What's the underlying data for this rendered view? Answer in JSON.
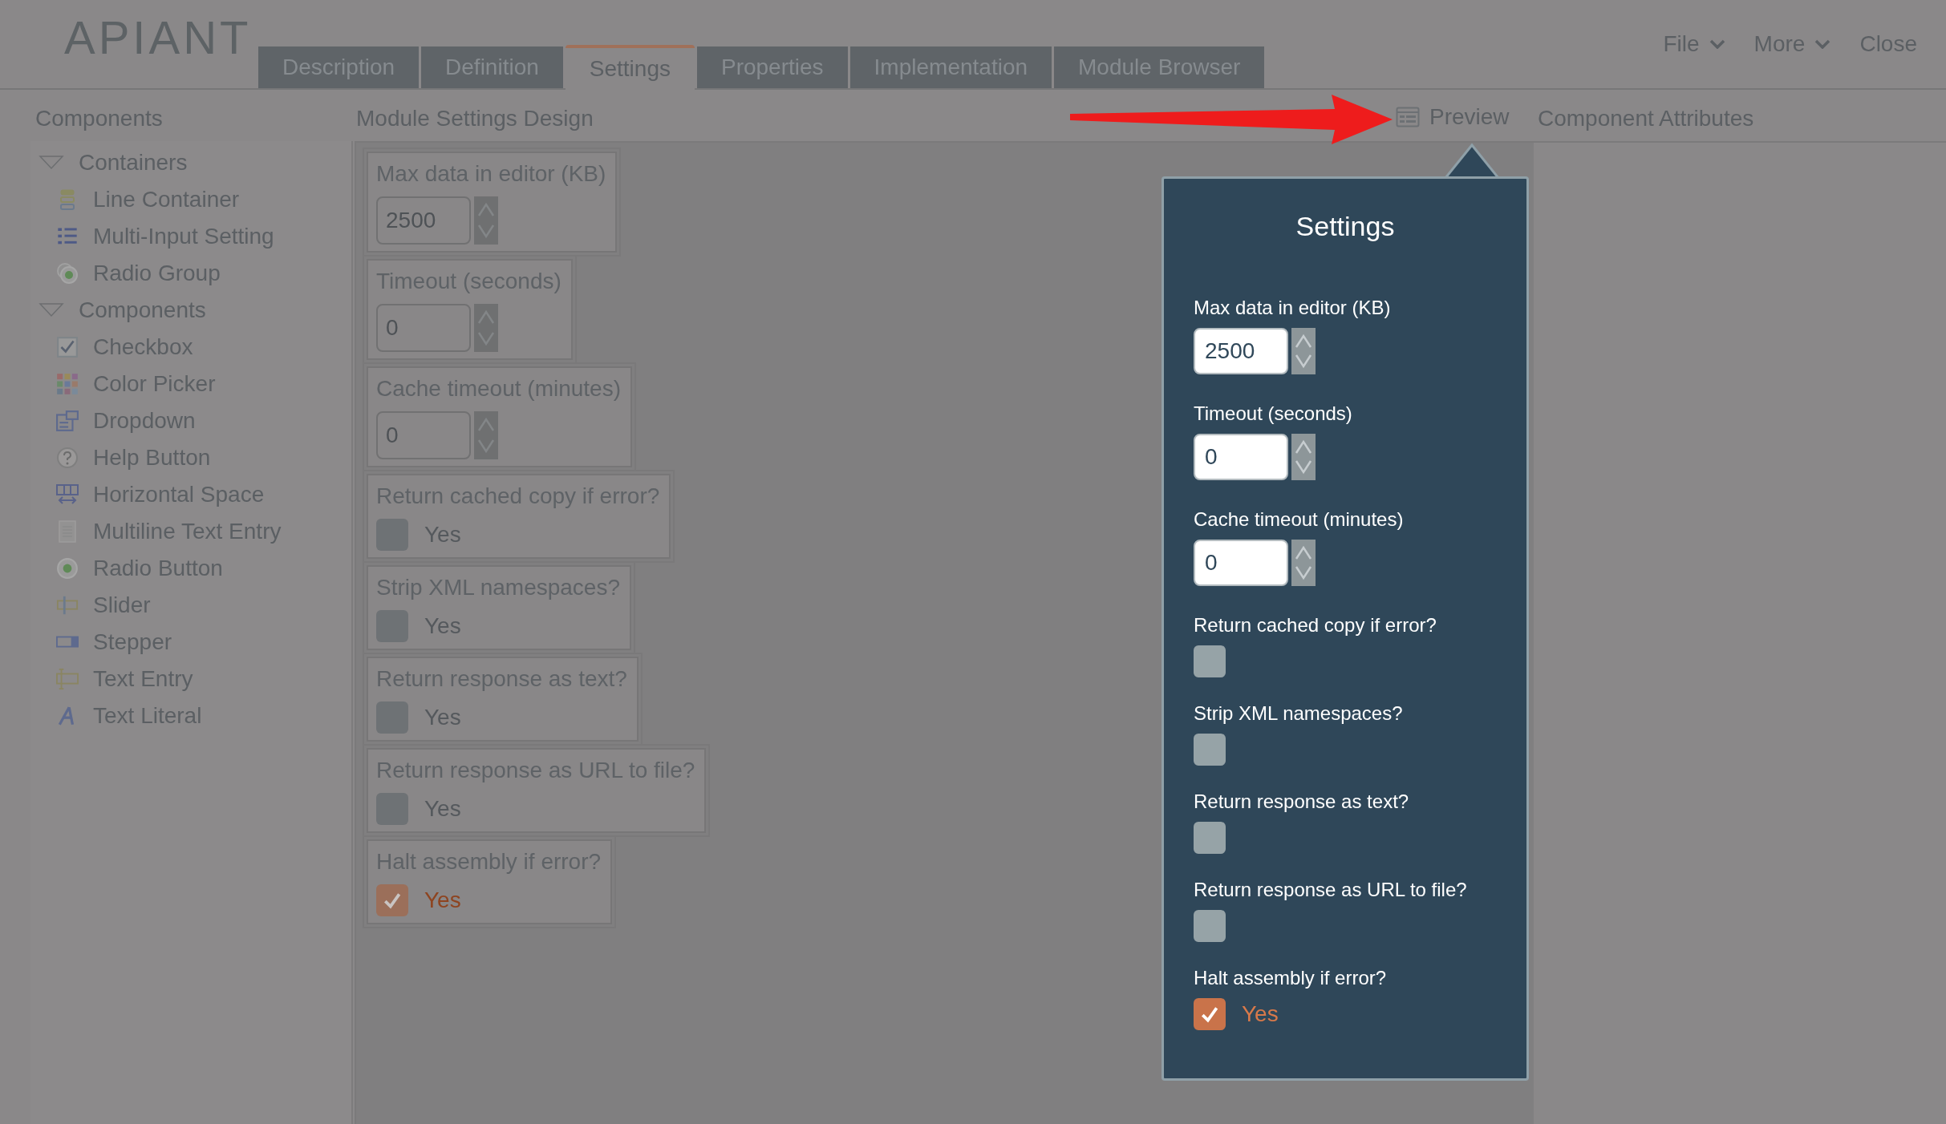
{
  "logo": "APIANT",
  "tabs": [
    {
      "label": "Description",
      "selected": false
    },
    {
      "label": "Definition",
      "selected": false
    },
    {
      "label": "Settings",
      "selected": true
    },
    {
      "label": "Properties",
      "selected": false
    },
    {
      "label": "Implementation",
      "selected": false
    },
    {
      "label": "Module Browser",
      "selected": false
    }
  ],
  "menu": [
    {
      "label": "File",
      "kind": "dropdown"
    },
    {
      "label": "More",
      "kind": "dropdown"
    },
    {
      "label": "Close",
      "kind": "link"
    }
  ],
  "components_panel": {
    "title": "Components",
    "tree": [
      {
        "label": "Containers",
        "expanded": true,
        "children": [
          {
            "label": "Line Container",
            "kind": "stack"
          },
          {
            "label": "Multi-Input Setting",
            "kind": "list"
          },
          {
            "label": "Radio Group",
            "kind": "radiogroup"
          }
        ]
      },
      {
        "label": "Components",
        "expanded": true,
        "children": [
          {
            "label": "Checkbox",
            "kind": "checkbox"
          },
          {
            "label": "Color Picker",
            "kind": "palette"
          },
          {
            "label": "Dropdown",
            "kind": "dropdown"
          },
          {
            "label": "Help Button",
            "kind": "help"
          },
          {
            "label": "Horizontal Space",
            "kind": "hspace"
          },
          {
            "label": "Multiline Text Entry",
            "kind": "document"
          },
          {
            "label": "Radio Button",
            "kind": "radio"
          },
          {
            "label": "Slider",
            "kind": "slider"
          },
          {
            "label": "Stepper",
            "kind": "stepper"
          },
          {
            "label": "Text Entry",
            "kind": "textentry"
          },
          {
            "label": "Text Literal",
            "kind": "literal"
          }
        ]
      }
    ]
  },
  "design": {
    "title": "Module Settings Design",
    "fields": [
      {
        "kind": "number",
        "label": "Max data in editor (KB)",
        "value": "2500"
      },
      {
        "kind": "number",
        "label": "Timeout (seconds)",
        "value": "0"
      },
      {
        "kind": "number",
        "label": "Cache timeout (minutes)",
        "value": "0"
      },
      {
        "kind": "checkbox",
        "label": "Return cached copy if error?",
        "option": "Yes",
        "checked": false
      },
      {
        "kind": "checkbox",
        "label": "Strip XML namespaces?",
        "option": "Yes",
        "checked": false
      },
      {
        "kind": "checkbox",
        "label": "Return response as text?",
        "option": "Yes",
        "checked": false
      },
      {
        "kind": "checkbox",
        "label": "Return response as URL to file?",
        "option": "Yes",
        "checked": false
      },
      {
        "kind": "checkbox",
        "label": "Halt assembly if error?",
        "option": "Yes",
        "checked": true
      }
    ]
  },
  "preview_button": "Preview",
  "attributes_panel": {
    "title": "Component Attributes"
  },
  "preview_popup": {
    "title": "Settings",
    "fields": [
      {
        "kind": "number",
        "label": "Max data in editor (KB)",
        "value": "2500"
      },
      {
        "kind": "number",
        "label": "Timeout (seconds)",
        "value": "0"
      },
      {
        "kind": "number",
        "label": "Cache timeout (minutes)",
        "value": "0"
      },
      {
        "kind": "checkbox",
        "label": "Return cached copy if error?",
        "checked": false
      },
      {
        "kind": "checkbox",
        "label": "Strip XML namespaces?",
        "checked": false
      },
      {
        "kind": "checkbox",
        "label": "Return response as text?",
        "checked": false
      },
      {
        "kind": "checkbox",
        "label": "Return response as URL to file?",
        "checked": false
      },
      {
        "kind": "checkbox",
        "label": "Halt assembly if error?",
        "option": "Yes",
        "checked": true
      }
    ]
  }
}
